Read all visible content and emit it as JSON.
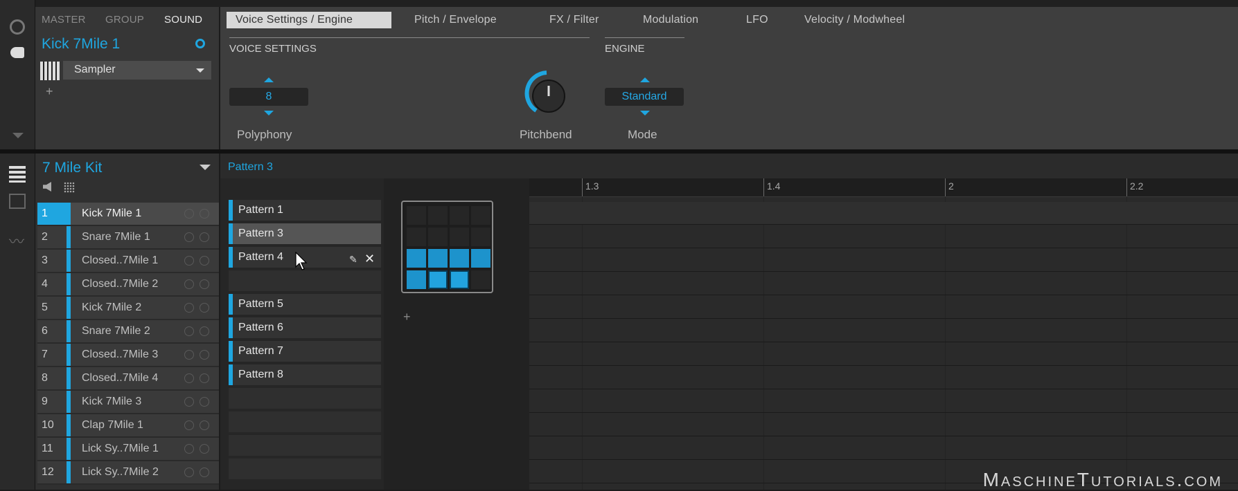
{
  "header": {
    "nav_tabs": [
      "MASTER",
      "GROUP",
      "SOUND"
    ],
    "active_nav": "SOUND",
    "sound_name": "Kick 7Mile 1",
    "plugin_name": "Sampler",
    "add_plugin": "+"
  },
  "param_tabs": [
    "Voice Settings / Engine",
    "Pitch / Envelope",
    "FX / Filter",
    "Modulation",
    "LFO",
    "Velocity / Modwheel"
  ],
  "voice_settings": {
    "title": "VOICE SETTINGS",
    "polyphony_value": "8",
    "polyphony_label": "Polyphony",
    "pitchbend_label": "Pitchbend",
    "pitchbend_level": 0.45
  },
  "engine": {
    "title": "ENGINE",
    "mode_value": "Standard",
    "mode_label": "Mode"
  },
  "group": {
    "name": "7 Mile Kit",
    "sounds": [
      {
        "num": "1",
        "name": "Kick 7Mile 1"
      },
      {
        "num": "2",
        "name": "Snare 7Mile 1"
      },
      {
        "num": "3",
        "name": "Closed..7Mile 1"
      },
      {
        "num": "4",
        "name": "Closed..7Mile 2"
      },
      {
        "num": "5",
        "name": "Kick 7Mile 2"
      },
      {
        "num": "6",
        "name": "Snare 7Mile 2"
      },
      {
        "num": "7",
        "name": "Closed..7Mile 3"
      },
      {
        "num": "8",
        "name": "Closed..7Mile 4"
      },
      {
        "num": "9",
        "name": "Kick 7Mile 3"
      },
      {
        "num": "10",
        "name": "Clap 7Mile 1"
      },
      {
        "num": "11",
        "name": "Lick Sy..7Mile 1"
      },
      {
        "num": "12",
        "name": "Lick Sy..7Mile 2"
      }
    ]
  },
  "pattern": {
    "current": "Pattern 3",
    "items": [
      "Pattern 1",
      "Pattern 3",
      "Pattern 4",
      "",
      "Pattern 5",
      "Pattern 6",
      "Pattern 7",
      "Pattern 8"
    ],
    "add_bank": "+"
  },
  "ruler": [
    "1.3",
    "1.4",
    "2",
    "2.2"
  ],
  "watermark": "MaschineTutorials.com",
  "colors": {
    "accent": "#1fa6e0"
  }
}
